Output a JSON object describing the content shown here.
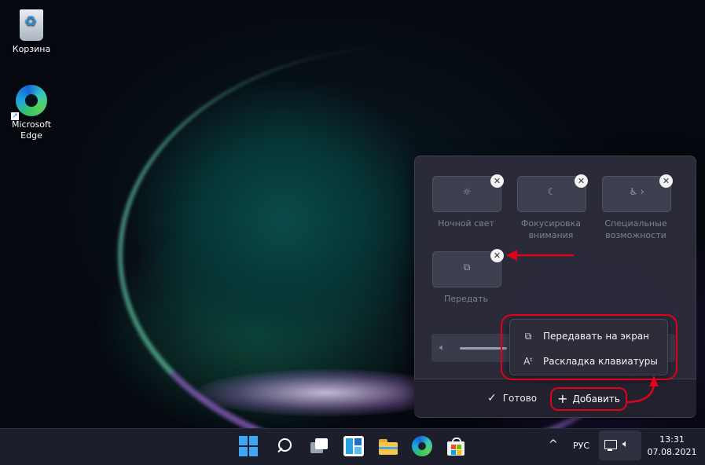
{
  "desktop": {
    "icons": [
      {
        "label": "Корзина",
        "icon": "recycle-bin-icon"
      },
      {
        "label": "Microsoft Edge",
        "icon": "edge-icon"
      }
    ]
  },
  "quick_settings": {
    "tiles": [
      {
        "label": "Ночной свет",
        "icon": "night-light-icon"
      },
      {
        "label": "Фокусировка внимания",
        "icon": "focus-assist-icon"
      },
      {
        "label": "Специальные возможности",
        "icon": "accessibility-icon"
      },
      {
        "label": "Передать",
        "icon": "cast-icon"
      }
    ],
    "unpin_glyph": "✕",
    "volume_icon": "speaker-icon",
    "volume_level": 0.2,
    "add_menu": {
      "items": [
        {
          "label": "Передавать на экран",
          "icon": "project-icon"
        },
        {
          "label": "Раскладка клавиатуры",
          "icon": "keyboard-layout-icon"
        }
      ]
    },
    "footer": {
      "done_label": "Готово",
      "add_label": "Добавить"
    }
  },
  "taskbar": {
    "icons": [
      "start-icon",
      "search-icon",
      "task-view-icon",
      "widgets-icon",
      "file-explorer-icon",
      "edge-icon",
      "store-icon"
    ],
    "tray": {
      "chevron": "^",
      "language": "РУС",
      "time": "13:31",
      "date": "07.08.2021"
    }
  },
  "annotation_color": "#e3001b"
}
